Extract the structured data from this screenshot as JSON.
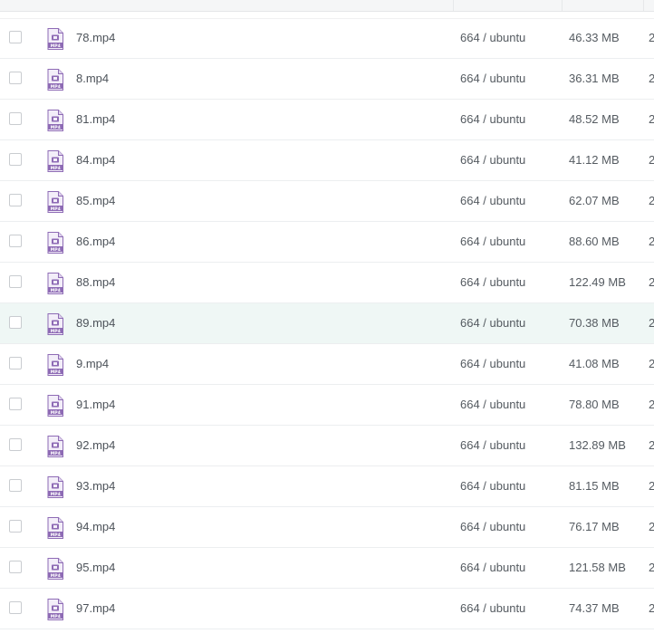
{
  "files": [
    {
      "name": "78.mp4",
      "owner": "664 / ubuntu",
      "size": "46.33 MB",
      "date": "2"
    },
    {
      "name": "8.mp4",
      "owner": "664 / ubuntu",
      "size": "36.31 MB",
      "date": "2"
    },
    {
      "name": "81.mp4",
      "owner": "664 / ubuntu",
      "size": "48.52 MB",
      "date": "2"
    },
    {
      "name": "84.mp4",
      "owner": "664 / ubuntu",
      "size": "41.12 MB",
      "date": "2"
    },
    {
      "name": "85.mp4",
      "owner": "664 / ubuntu",
      "size": "62.07 MB",
      "date": "2"
    },
    {
      "name": "86.mp4",
      "owner": "664 / ubuntu",
      "size": "88.60 MB",
      "date": "2"
    },
    {
      "name": "88.mp4",
      "owner": "664 / ubuntu",
      "size": "122.49 MB",
      "date": "2"
    },
    {
      "name": "89.mp4",
      "owner": "664 / ubuntu",
      "size": "70.38 MB",
      "date": "2",
      "highlighted": true
    },
    {
      "name": "9.mp4",
      "owner": "664 / ubuntu",
      "size": "41.08 MB",
      "date": "2"
    },
    {
      "name": "91.mp4",
      "owner": "664 / ubuntu",
      "size": "78.80 MB",
      "date": "2"
    },
    {
      "name": "92.mp4",
      "owner": "664 / ubuntu",
      "size": "132.89 MB",
      "date": "2"
    },
    {
      "name": "93.mp4",
      "owner": "664 / ubuntu",
      "size": "81.15 MB",
      "date": "2"
    },
    {
      "name": "94.mp4",
      "owner": "664 / ubuntu",
      "size": "76.17 MB",
      "date": "2"
    },
    {
      "name": "95.mp4",
      "owner": "664 / ubuntu",
      "size": "121.58 MB",
      "date": "2"
    },
    {
      "name": "97.mp4",
      "owner": "664 / ubuntu",
      "size": "74.37 MB",
      "date": "2"
    }
  ],
  "icon": {
    "type": "mp4-file-icon",
    "label": "MP4",
    "color": "#8e6bb5",
    "light_color": "#e9e1f3"
  },
  "colors": {
    "row_highlight": "#eff7f5",
    "text": "#555b61",
    "border": "#eceef0"
  }
}
